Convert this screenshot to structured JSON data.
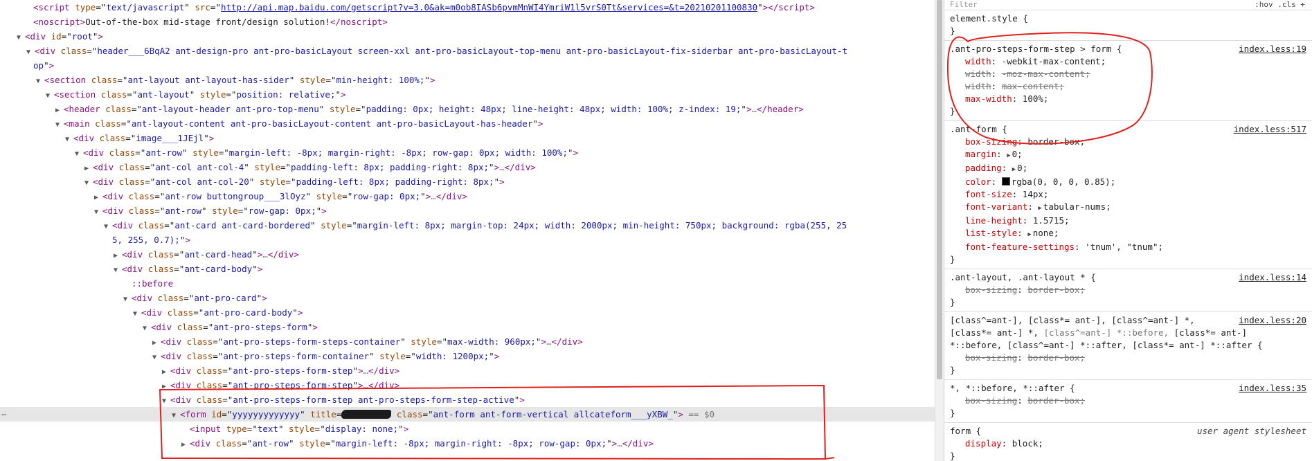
{
  "elements": {
    "lines": [
      {
        "ind": 0,
        "tri": "",
        "html": "<span class='tg'>&lt;script</span> <span class='an'>type</span>=\"<span class='av'>text/javascript</span>\" <span class='an'>src</span>=\"<span class='lk'>http://api.map.baidu.com/getscript?v=3.0&amp;ak=m0ob8IASb6pvmMnWI4YmriW1l5vrS0Tt&amp;services=&amp;t=20210201100830</span>\"<span class='tg'>&gt;&lt;/script&gt;</span>"
      },
      {
        "ind": 0,
        "tri": "",
        "html": "<span class='tg'>&lt;noscript&gt;</span>Out-of-the-box mid-stage front/design solution!<span class='tg'>&lt;/noscript&gt;</span>"
      },
      {
        "ind": 0,
        "tri": "open",
        "html": "<span class='tg'>&lt;div</span> <span class='an'>id</span>=\"<span class='av'>root</span>\"<span class='tg'>&gt;</span>"
      },
      {
        "ind": 1,
        "tri": "open",
        "html": "<span class='tg'>&lt;div</span> <span class='an'>class</span>=\"<span class='av'>header___6BqA2 ant-design-pro ant-pro-basicLayout screen-xxl ant-pro-basicLayout-top-menu ant-pro-basicLayout-fix-siderbar ant-pro-basicLayout-t</span>"
      },
      {
        "ind": 0,
        "tri": "",
        "html": "<span class='av'>op</span>\"<span class='tg'>&gt;</span>"
      },
      {
        "ind": 2,
        "tri": "open",
        "html": "<span class='tg'>&lt;section</span> <span class='an'>class</span>=\"<span class='av'>ant-layout ant-layout-has-sider</span>\" <span class='an'>style</span>=\"<span class='av'>min-height: 100%;</span>\"<span class='tg'>&gt;</span>"
      },
      {
        "ind": 3,
        "tri": "open",
        "html": "<span class='tg'>&lt;section</span> <span class='an'>class</span>=\"<span class='av'>ant-layout</span>\" <span class='an'>style</span>=\"<span class='av'>position: relative;</span>\"<span class='tg'>&gt;</span>"
      },
      {
        "ind": 4,
        "tri": "closed",
        "html": "<span class='tg'>&lt;header</span> <span class='an'>class</span>=\"<span class='av'>ant-layout-header ant-pro-top-menu</span>\" <span class='an'>style</span>=\"<span class='av'>padding: 0px; height: 48px; line-height: 48px; width: 100%; z-index: 19;</span>\"<span class='tg'>&gt;</span><span class='dots'>…</span><span class='tg'>&lt;/header&gt;</span>"
      },
      {
        "ind": 4,
        "tri": "open",
        "html": "<span class='tg'>&lt;main</span> <span class='an'>class</span>=\"<span class='av'>ant-layout-content ant-pro-basicLayout-content ant-pro-basicLayout-has-header</span>\"<span class='tg'>&gt;</span>"
      },
      {
        "ind": 5,
        "tri": "open",
        "html": "<span class='tg'>&lt;div</span> <span class='an'>class</span>=\"<span class='av'>image___1JEjl</span>\"<span class='tg'>&gt;</span>"
      },
      {
        "ind": 6,
        "tri": "open",
        "html": "<span class='tg'>&lt;div</span> <span class='an'>class</span>=\"<span class='av'>ant-row</span>\" <span class='an'>style</span>=\"<span class='av'>margin-left: -8px; margin-right: -8px; row-gap: 0px; width: 100%;</span>\"<span class='tg'>&gt;</span>"
      },
      {
        "ind": 7,
        "tri": "closed",
        "html": "<span class='tg'>&lt;div</span> <span class='an'>class</span>=\"<span class='av'>ant-col ant-col-4</span>\" <span class='an'>style</span>=\"<span class='av'>padding-left: 8px; padding-right: 8px;</span>\"<span class='tg'>&gt;</span><span class='dots'>…</span><span class='tg'>&lt;/div&gt;</span>"
      },
      {
        "ind": 7,
        "tri": "open",
        "html": "<span class='tg'>&lt;div</span> <span class='an'>class</span>=\"<span class='av'>ant-col ant-col-20</span>\" <span class='an'>style</span>=\"<span class='av'>padding-left: 8px; padding-right: 8px;</span>\"<span class='tg'>&gt;</span>"
      },
      {
        "ind": 8,
        "tri": "closed",
        "html": "<span class='tg'>&lt;div</span> <span class='an'>class</span>=\"<span class='av'>ant-row buttongroup___3lOyz</span>\" <span class='an'>style</span>=\"<span class='av'>row-gap: 0px;</span>\"<span class='tg'>&gt;</span><span class='dots'>…</span><span class='tg'>&lt;/div&gt;</span>"
      },
      {
        "ind": 8,
        "tri": "open",
        "html": "<span class='tg'>&lt;div</span> <span class='an'>class</span>=\"<span class='av'>ant-row</span>\" <span class='an'>style</span>=\"<span class='av'>row-gap: 0px;</span>\"<span class='tg'>&gt;</span>"
      },
      {
        "ind": 9,
        "tri": "open",
        "html": "<span class='tg'>&lt;div</span> <span class='an'>class</span>=\"<span class='av'>ant-card ant-card-bordered</span>\" <span class='an'>style</span>=\"<span class='av'>margin-left: 8px; margin-top: 24px; width: 2000px; min-height: 750px; background: rgba(255, 25</span>"
      },
      {
        "ind": 9,
        "tri": "",
        "html": "<span class='av'>5, 255, 0.7);</span>\"<span class='tg'>&gt;</span>"
      },
      {
        "ind": 10,
        "tri": "closed",
        "html": "<span class='tg'>&lt;div</span> <span class='an'>class</span>=\"<span class='av'>ant-card-head</span>\"<span class='tg'>&gt;</span><span class='dots'>…</span><span class='tg'>&lt;/div&gt;</span>"
      },
      {
        "ind": 10,
        "tri": "open",
        "html": "<span class='tg'>&lt;div</span> <span class='an'>class</span>=\"<span class='av'>ant-card-body</span>\"<span class='tg'>&gt;</span>"
      },
      {
        "ind": 11,
        "tri": "",
        "html": "<span class='pe'>::before</span>"
      },
      {
        "ind": 11,
        "tri": "open",
        "html": "<span class='tg'>&lt;div</span> <span class='an'>class</span>=\"<span class='av'>ant-pro-card</span>\"<span class='tg'>&gt;</span>"
      },
      {
        "ind": 12,
        "tri": "open",
        "html": "<span class='tg'>&lt;div</span> <span class='an'>class</span>=\"<span class='av'>ant-pro-card-body</span>\"<span class='tg'>&gt;</span>"
      },
      {
        "ind": 13,
        "tri": "open",
        "html": "<span class='tg'>&lt;div</span> <span class='an'>class</span>=\"<span class='av'>ant-pro-steps-form</span>\"<span class='tg'>&gt;</span>"
      },
      {
        "ind": 14,
        "tri": "closed",
        "html": "<span class='tg'>&lt;div</span> <span class='an'>class</span>=\"<span class='av'>ant-pro-steps-form-steps-container</span>\" <span class='an'>style</span>=\"<span class='av'>max-width: 960px;</span>\"<span class='tg'>&gt;</span><span class='dots'>…</span><span class='tg'>&lt;/div&gt;</span>"
      },
      {
        "ind": 14,
        "tri": "open",
        "html": "<span class='tg'>&lt;div</span> <span class='an'>class</span>=\"<span class='av'>ant-pro-steps-form-container</span>\" <span class='an'>style</span>=\"<span class='av'>width: 1200px;</span>\"<span class='tg'>&gt;</span>"
      },
      {
        "ind": 15,
        "tri": "closed",
        "html": "<span class='tg'>&lt;div</span> <span class='an'>class</span>=\"<span class='av'>ant-pro-steps-form-step</span>\"<span class='tg'>&gt;</span><span class='dots'>…</span><span class='tg'>&lt;/div&gt;</span>"
      },
      {
        "ind": 15,
        "tri": "closed",
        "html": "<span class='tg'>&lt;div</span> <span class='an'>class</span>=\"<span class='av'>ant-pro-steps-form-step</span>\"<span class='tg'>&gt;</span><span class='dots'>…</span><span class='tg'>&lt;/div&gt;</span>"
      },
      {
        "ind": 15,
        "tri": "open",
        "html": "<span class='tg'>&lt;div</span> <span class='an'>class</span>=\"<span class='av'>ant-pro-steps-form-step ant-pro-steps-form-step-active</span>\"<span class='tg'>&gt;</span>"
      },
      {
        "ind": 16,
        "tri": "open",
        "sel": true,
        "html": "<span class='tg'>&lt;form</span> <span class='an'>id</span>=\"<span class='av'>yyyyyyyyyyyyy</span>\" <span class='an'>title</span>=<span class='redact'></span> <span class='an'>class</span>=\"<span class='av'>ant-form ant-form-vertical allcateform___yXBW_</span>\"<span class='tg'>&gt;</span> <span class='gr'>== $0</span>"
      },
      {
        "ind": 17,
        "tri": "",
        "html": "<span class='tg'>&lt;input</span> <span class='an'>type</span>=\"<span class='av'>text</span>\" <span class='an'>style</span>=\"<span class='av'>display: none;</span>\"<span class='tg'>&gt;</span>"
      },
      {
        "ind": 17,
        "tri": "closed",
        "html": "<span class='tg'>&lt;div</span> <span class='an'>class</span>=\"<span class='av'>ant-row</span>\" <span class='an'>style</span>=\"<span class='av'>margin-left: -8px; margin-right: -8px; row-gap: 0px;</span>\"<span class='tg'>&gt;</span><span class='dots'>…</span><span class='tg'>&lt;/div&gt;</span>"
      }
    ]
  },
  "styles": {
    "filter_placeholder": "Filter",
    "filter_icons": ":hov .cls +",
    "rules": [
      {
        "selector": "element.style {",
        "source": "",
        "decls": []
      },
      {
        "selector": ".ant-pro-steps-form-step > form {",
        "source": "index.less:19",
        "decls": [
          {
            "p": "width",
            "v": "-webkit-max-content;",
            "off": false
          },
          {
            "p": "width",
            "v": "-moz-max-content;",
            "off": true
          },
          {
            "p": "width",
            "v": "max-content;",
            "off": true
          },
          {
            "p": "max-width",
            "v": "100%;",
            "off": false
          }
        ]
      },
      {
        "selector": ".ant-form {",
        "source": "index.less:517",
        "decls": [
          {
            "p": "box-sizing",
            "v": "border-box;",
            "off": false
          },
          {
            "p": "margin",
            "v": "0;",
            "off": false,
            "arrow": true
          },
          {
            "p": "padding",
            "v": "0;",
            "off": false,
            "arrow": true
          },
          {
            "p": "color",
            "v": "rgba(0, 0, 0, 0.85);",
            "off": false,
            "swatch": true
          },
          {
            "p": "font-size",
            "v": "14px;",
            "off": false
          },
          {
            "p": "font-variant",
            "v": "tabular-nums;",
            "off": false,
            "arrow": true
          },
          {
            "p": "line-height",
            "v": "1.5715;",
            "off": false
          },
          {
            "p": "list-style",
            "v": "none;",
            "off": false,
            "arrow": true
          },
          {
            "p": "font-feature-settings",
            "v": "'tnum', \"tnum\";",
            "off": false
          }
        ]
      },
      {
        "selector": ".ant-layout, .ant-layout * {",
        "source": "index.less:14",
        "decls": [
          {
            "p": "box-sizing",
            "v": "border-box;",
            "off": true
          }
        ]
      },
      {
        "selector": "[class^=ant-], [class*= ant-], [class^=ant-] *,\n[class*= ant-] *, [class^=ant-] *::before, [class*= ant-]\n*::before, [class^=ant-] *::after, [class*= ant-] *::after {",
        "source": "index.less:20",
        "decls": [
          {
            "p": "box-sizing",
            "v": "border-box;",
            "off": true
          }
        ]
      },
      {
        "selector": "*, *::before, *::after {",
        "source": "index.less:35",
        "decls": [
          {
            "p": "box-sizing",
            "v": "border-box;",
            "off": true
          }
        ]
      },
      {
        "selector": "form {",
        "source": "user agent stylesheet",
        "ua": true,
        "decls": [
          {
            "p": "display",
            "v": "block;",
            "off": false
          }
        ]
      }
    ]
  },
  "colors": {
    "annotation": "#e0201c",
    "tag": "#881280",
    "attr_name": "#994500",
    "attr_value": "#1a1aa6",
    "prop_name": "#c80000"
  }
}
